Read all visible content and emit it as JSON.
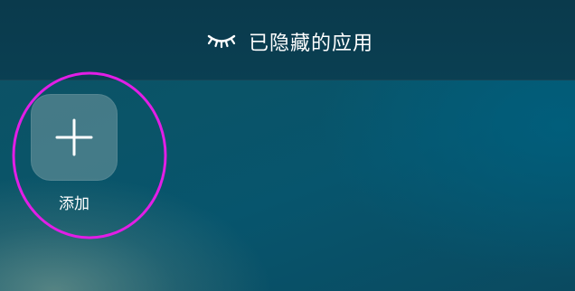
{
  "header": {
    "title": "已隐藏的应用",
    "icon": "closed-eye-icon"
  },
  "apps": [
    {
      "label": "添加",
      "icon": "plus-icon"
    }
  ],
  "colors": {
    "highlight_ring": "#e21ee6",
    "topbar": "#0a3d50",
    "background": "#07556d"
  }
}
